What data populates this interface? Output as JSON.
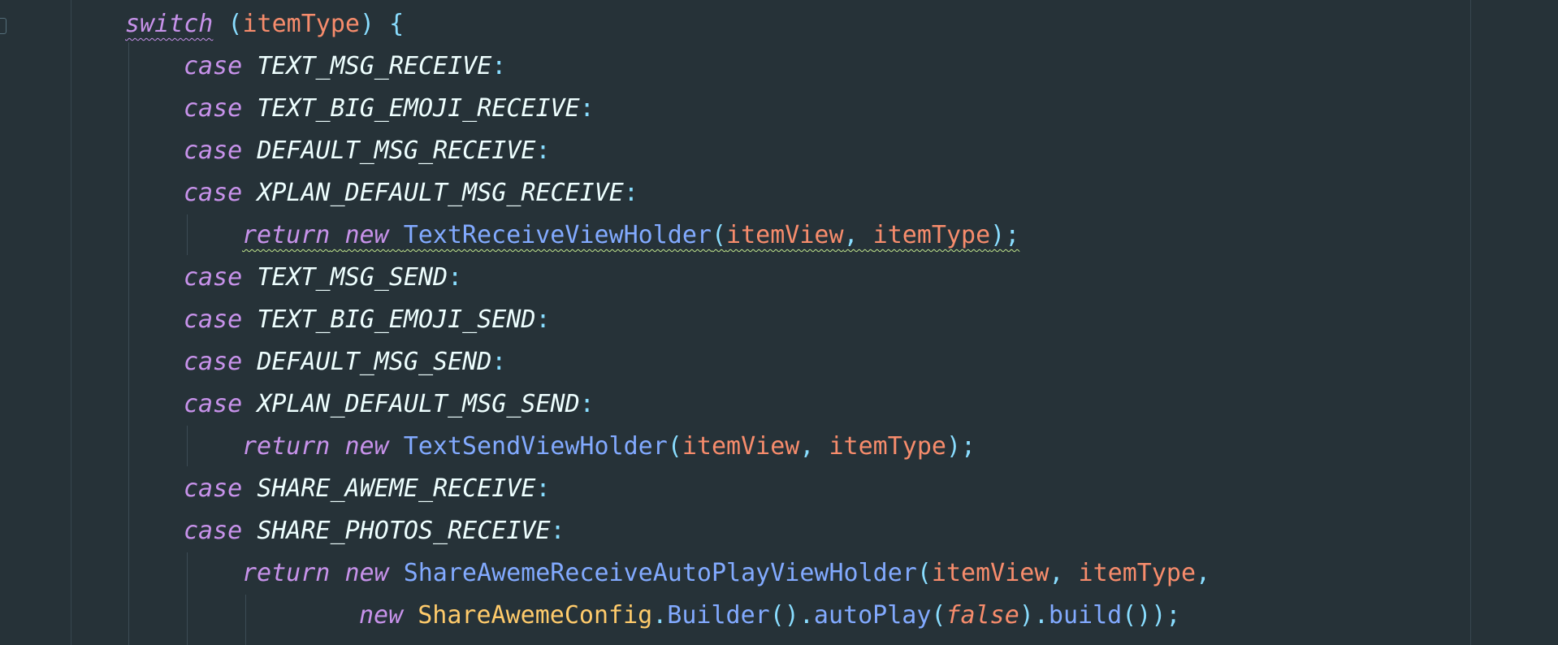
{
  "editor": {
    "theme_colors": {
      "background": "#263238",
      "keyword": "#c792ea",
      "constant": "#eeffff",
      "punctuation": "#89ddff",
      "variable": "#f78c6c",
      "class": "#82aaff",
      "type": "#ffcb6b"
    },
    "code": {
      "switch_kw": "switch",
      "switch_open_paren": " (",
      "switch_var": "itemType",
      "switch_close": ") {",
      "case_kw": "case",
      "colon": ":",
      "return_kw": "return",
      "new_kw": "new",
      "comma": ", ",
      "open_paren": "(",
      "close_paren_semi": ");",
      "item_view": "itemView",
      "item_type": "itemType",
      "cases": [
        "TEXT_MSG_RECEIVE",
        "TEXT_BIG_EMOJI_RECEIVE",
        "DEFAULT_MSG_RECEIVE",
        "XPLAN_DEFAULT_MSG_RECEIVE",
        "TEXT_MSG_SEND",
        "TEXT_BIG_EMOJI_SEND",
        "DEFAULT_MSG_SEND",
        "XPLAN_DEFAULT_MSG_SEND",
        "SHARE_AWEME_RECEIVE",
        "SHARE_PHOTOS_RECEIVE"
      ],
      "holders": {
        "text_receive": "TextReceiveViewHolder",
        "text_send": "TextSendViewHolder",
        "share_aweme": "ShareAwemeReceiveAutoPlayViewHolder"
      },
      "last_line": {
        "config_class": "ShareAwemeConfig",
        "dot1": ".",
        "builder": "Builder",
        "call_empty": "()",
        "dot2": ".",
        "auto_play": "autoPlay",
        "open": "(",
        "false_literal": "false",
        "close": ")",
        "dot3": ".",
        "build": "build",
        "end": "());",
        "trailing_comma": ","
      }
    }
  }
}
